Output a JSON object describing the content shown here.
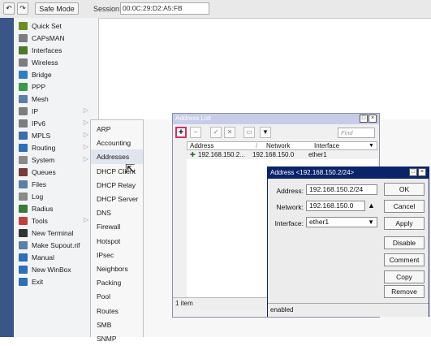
{
  "topbar": {
    "undo_label": "↶",
    "redo_label": "↷",
    "safe_mode_label": "Safe Mode",
    "session_label": "Session:",
    "session_value": "00:0C:29:D2:A5:FB"
  },
  "sidebar": {
    "items": [
      {
        "label": "Quick Set",
        "icon": "wrench-icon",
        "color": "#6b8e23"
      },
      {
        "label": "CAPsMAN",
        "icon": "antenna-icon",
        "color": "#7d7d7d"
      },
      {
        "label": "Interfaces",
        "icon": "interfaces-icon",
        "color": "#4a7a2a"
      },
      {
        "label": "Wireless",
        "icon": "antenna-icon",
        "color": "#7d7d7d"
      },
      {
        "label": "Bridge",
        "icon": "bridge-icon",
        "color": "#2e7fc1"
      },
      {
        "label": "PPP",
        "icon": "ppp-icon",
        "color": "#3a9a4a"
      },
      {
        "label": "Mesh",
        "icon": "mesh-icon",
        "color": "#5a7fa8"
      },
      {
        "label": "IP",
        "icon": "ip-icon",
        "color": "#7d7d7d",
        "arrow": "▷"
      },
      {
        "label": "IPv6",
        "icon": "ipv6-icon",
        "color": "#7d7d7d",
        "arrow": "▷"
      },
      {
        "label": "MPLS",
        "icon": "mpls-icon",
        "color": "#3a6ea8",
        "arrow": "▷"
      },
      {
        "label": "Routing",
        "icon": "routing-icon",
        "color": "#2e6fb5",
        "arrow": "▷"
      },
      {
        "label": "System",
        "icon": "gear-icon",
        "color": "#8a8a8a",
        "arrow": "▷"
      },
      {
        "label": "Queues",
        "icon": "queues-icon",
        "color": "#7a3a3a"
      },
      {
        "label": "Files",
        "icon": "folder-icon",
        "color": "#5a7fa8"
      },
      {
        "label": "Log",
        "icon": "log-icon",
        "color": "#8a8a8a"
      },
      {
        "label": "Radius",
        "icon": "radius-icon",
        "color": "#3a7a3a"
      },
      {
        "label": "Tools",
        "icon": "tools-icon",
        "color": "#c04040",
        "arrow": "▷"
      },
      {
        "label": "New Terminal",
        "icon": "terminal-icon",
        "color": "#333333"
      },
      {
        "label": "Make Supout.rif",
        "icon": "document-icon",
        "color": "#5a7fa8"
      },
      {
        "label": "Manual",
        "icon": "help-icon",
        "color": "#2e6fb5"
      },
      {
        "label": "New WinBox",
        "icon": "winbox-icon",
        "color": "#2e6fb5"
      },
      {
        "label": "Exit",
        "icon": "exit-icon",
        "color": "#2e6fb5"
      }
    ]
  },
  "ip_submenu": {
    "items": [
      "ARP",
      "Accounting",
      "Addresses",
      "DHCP Client",
      "DHCP Relay",
      "DHCP Server",
      "DNS",
      "Firewall",
      "Hotspot",
      "IPsec",
      "Neighbors",
      "Packing",
      "Pool",
      "Routes",
      "SMB",
      "SNMP"
    ],
    "hovered": "Addresses"
  },
  "address_list": {
    "title": "Address List",
    "find_placeholder": "Find",
    "columns": [
      "Address",
      "Network",
      "Interface"
    ],
    "rows": [
      {
        "address": "192.168.150.2...",
        "network": "192.168.150.0",
        "interface": "ether1"
      }
    ],
    "status": "1 item",
    "controls": {
      "restore": "□",
      "close": "×"
    },
    "toolbar": {
      "add": "+",
      "remove": "−",
      "enable": "✓",
      "disable": "✕",
      "comment": "▭",
      "filter": "▼"
    }
  },
  "address_dialog": {
    "title": "Address <192.168.150.2/24>",
    "controls": {
      "restore": "□",
      "close": "×"
    },
    "fields": {
      "address_label": "Address:",
      "address_value": "192.168.150.2/24",
      "network_label": "Network:",
      "network_value": "192.168.150.0",
      "interface_label": "Interface:",
      "interface_value": "ether1"
    },
    "buttons": {
      "ok": "OK",
      "cancel": "Cancel",
      "apply": "Apply",
      "disable": "Disable",
      "comment": "Comment",
      "copy": "Copy",
      "remove": "Remove"
    },
    "status": "enabled"
  },
  "colors": {
    "accent": "#0a246a",
    "sidebar_strip": "#3a5588",
    "add_highlight": "#d0306a"
  }
}
